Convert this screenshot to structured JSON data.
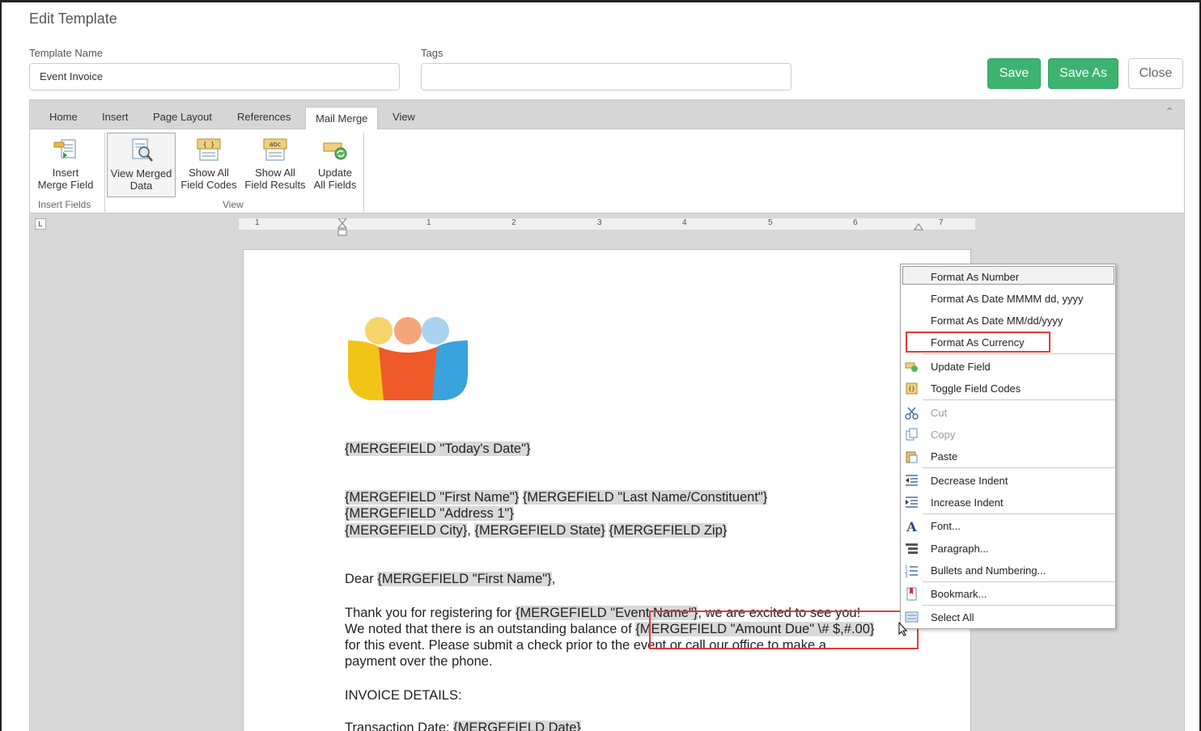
{
  "dialog": {
    "title": "Edit Template",
    "template_name_label": "Template Name",
    "template_name_value": "Event Invoice",
    "tags_label": "Tags",
    "tags_value": "",
    "save_label": "Save",
    "save_as_label": "Save As",
    "close_label": "Close"
  },
  "ribbon": {
    "tabs": [
      "Home",
      "Insert",
      "Page Layout",
      "References",
      "Mail Merge",
      "View"
    ],
    "active_tab": "Mail Merge",
    "buttons": {
      "insert_merge_field": [
        "Insert",
        "Merge Field"
      ],
      "view_merged_data": [
        "View Merged",
        "Data"
      ],
      "show_all_field_codes": [
        "Show All",
        "Field Codes"
      ],
      "show_all_field_results": [
        "Show All",
        "Field Results"
      ],
      "update_all_fields": [
        "Update",
        "All Fields"
      ]
    },
    "groups": {
      "insert_fields": "Insert Fields",
      "view": "View"
    }
  },
  "ruler": {
    "numbers": [
      "1",
      "1",
      "2",
      "3",
      "4",
      "5",
      "6",
      "7"
    ]
  },
  "document": {
    "todays_date": "{MERGEFIELD \"Today's Date\"}",
    "first_name": "{MERGEFIELD \"First Name\"}",
    "last_name": "{MERGEFIELD \"Last Name/Constituent\"}",
    "address": "{MERGEFIELD \"Address 1\"}",
    "city": "{MERGEFIELD City}",
    "state": "{MERGEFIELD State}",
    "zip": "{MERGEFIELD Zip}",
    "dear": "Dear ",
    "dear_name": "{MERGEFIELD \"First Name\"}",
    "comma": ",",
    "sep_comma": ", ",
    "thank_you": "Thank you for registering for ",
    "event_name": "{MERGEFIELD \"Event Name\"}",
    "excited": ", we are excited to see you!",
    "balance": "We noted that there is an outstanding balance of ",
    "amount_due": "{MERGEFIELD \"Amount Due\" \\# $,#.00}",
    "line3": "for this event.  Please submit a check prior to the event or call our office to make a",
    "line4": "payment over the phone.",
    "invoice_details": "INVOICE DETAILS:",
    "transaction_date_label": "Transaction Date: ",
    "transaction_date": "{MERGEFIELD Date}"
  },
  "context_menu": {
    "items": [
      "Format As Number",
      "Format As Date MMMM dd, yyyy",
      "Format As Date MM/dd/yyyy",
      "Format As Currency",
      "Update Field",
      "Toggle Field Codes",
      "Cut",
      "Copy",
      "Paste",
      "Decrease Indent",
      "Increase Indent",
      "Font...",
      "Paragraph...",
      "Bullets and Numbering...",
      "Bookmark...",
      "Select All"
    ],
    "highlighted": "Format As Number"
  },
  "colors": {
    "save_green": "#3cb371",
    "highlight_red": "#e03c3c",
    "mergefield_gray": "#d9d9d9"
  }
}
